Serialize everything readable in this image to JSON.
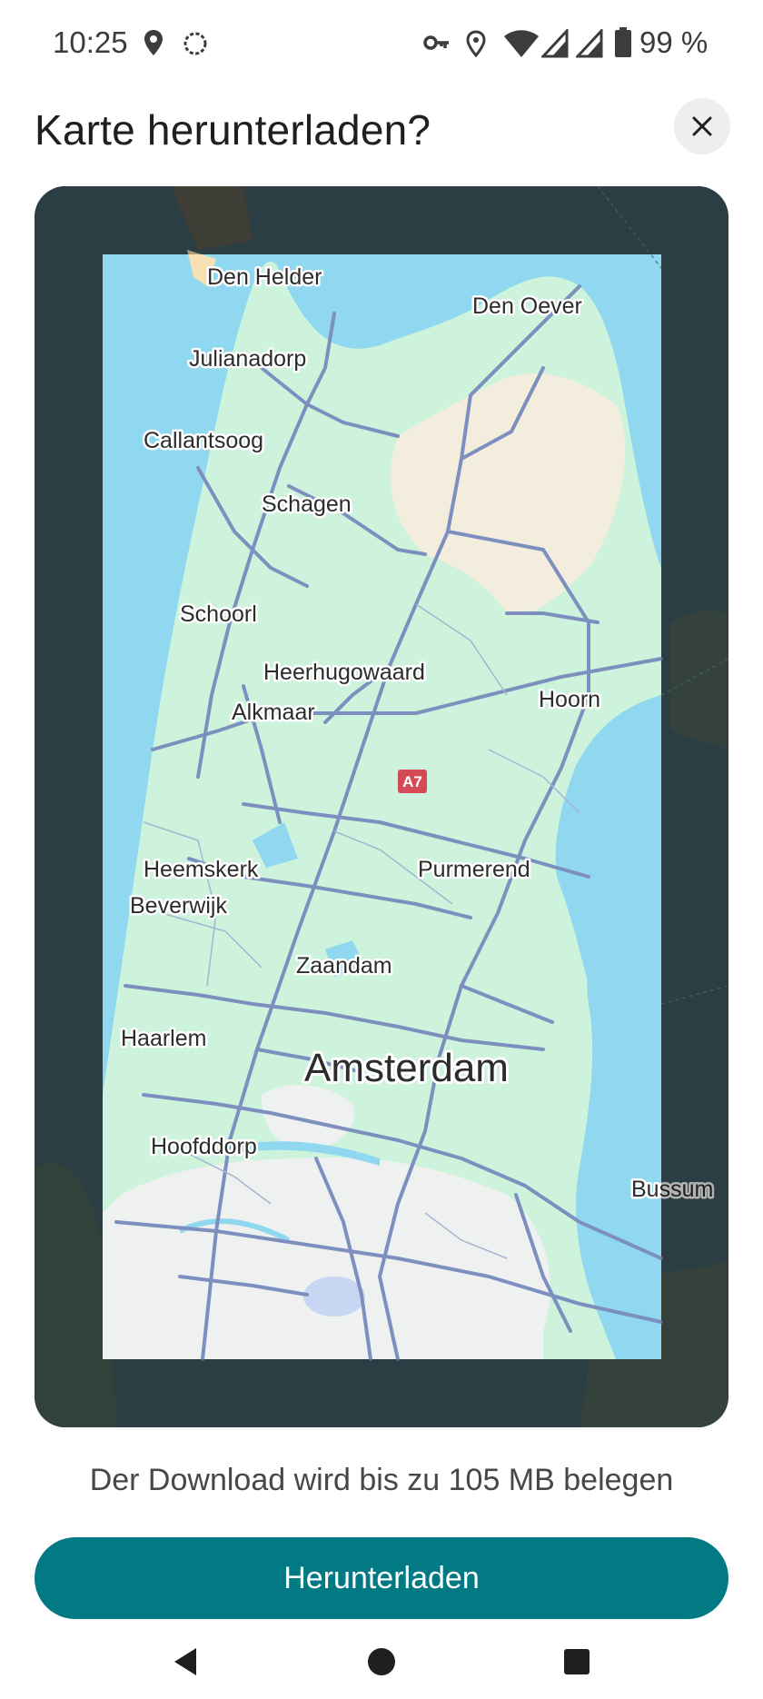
{
  "status_bar": {
    "time": "10:25",
    "battery_text": "99 %",
    "icons": [
      "location-icon",
      "assistant-icon",
      "vpn-key-icon",
      "location-icon",
      "wifi-icon",
      "signal-icon",
      "signal-icon",
      "battery-icon"
    ]
  },
  "dialog": {
    "title": "Karte herunterladen?",
    "close_icon": "close-icon"
  },
  "map": {
    "places": {
      "den_helder": "Den Helder",
      "den_oever": "Den Oever",
      "julianadorp": "Julianadorp",
      "callantsoog": "Callantsoog",
      "schagen": "Schagen",
      "schoorl": "Schoorl",
      "heerhugowaard": "Heerhugowaard",
      "alkmaar": "Alkmaar",
      "hoorn": "Hoorn",
      "heemskerk": "Heemskerk",
      "beverwijk": "Beverwijk",
      "purmerend": "Purmerend",
      "zaandam": "Zaandam",
      "haarlem": "Haarlem",
      "amsterdam": "Amsterdam",
      "hoofddorp": "Hoofddorp",
      "bussum": "Bussum"
    },
    "road_shield": "A7",
    "colors": {
      "water": "#8fd8f0",
      "land": "#cdf3dc",
      "outside_overlay": "#3d5a60"
    }
  },
  "footer": {
    "download_info": "Der Download wird bis zu 105 MB belegen",
    "download_button": "Herunterladen"
  },
  "nav_bar": {
    "back": "back-icon",
    "home": "home-icon",
    "recents": "recents-icon"
  }
}
